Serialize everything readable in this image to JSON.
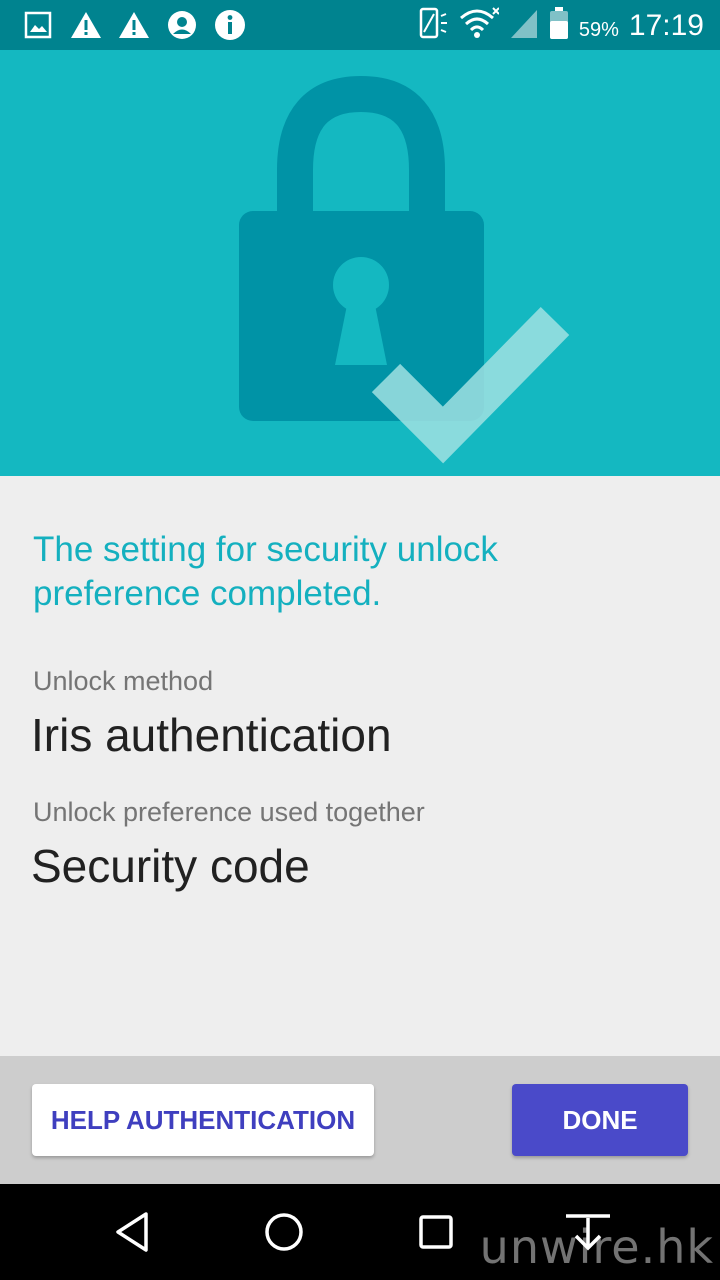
{
  "status_bar": {
    "battery_percent": "59%",
    "time": "17:19",
    "icons": [
      "gallery-icon",
      "warning-icon",
      "warning-icon",
      "vpn-icon",
      "info-icon",
      "screen-rotation-icon",
      "wifi-icon",
      "no-signal-icon",
      "battery-icon"
    ]
  },
  "main": {
    "headline": "The setting for security unlock preference completed.",
    "unlock_method_label": "Unlock method",
    "unlock_method_value": "Iris authentication",
    "preference_label": "Unlock preference used together",
    "preference_value": "Security code"
  },
  "footer": {
    "help_label": "HELP AUTHENTICATION",
    "done_label": "DONE"
  },
  "navigation": {
    "icons": [
      "back-icon",
      "home-icon",
      "recents-icon",
      "hide-keyboard-icon"
    ]
  },
  "watermark": "unwire.hk",
  "colors": {
    "status_bar": "#00838f",
    "hero": "#14b8c1",
    "accent": "#14b0bf",
    "done_button": "#4a4ac9"
  }
}
